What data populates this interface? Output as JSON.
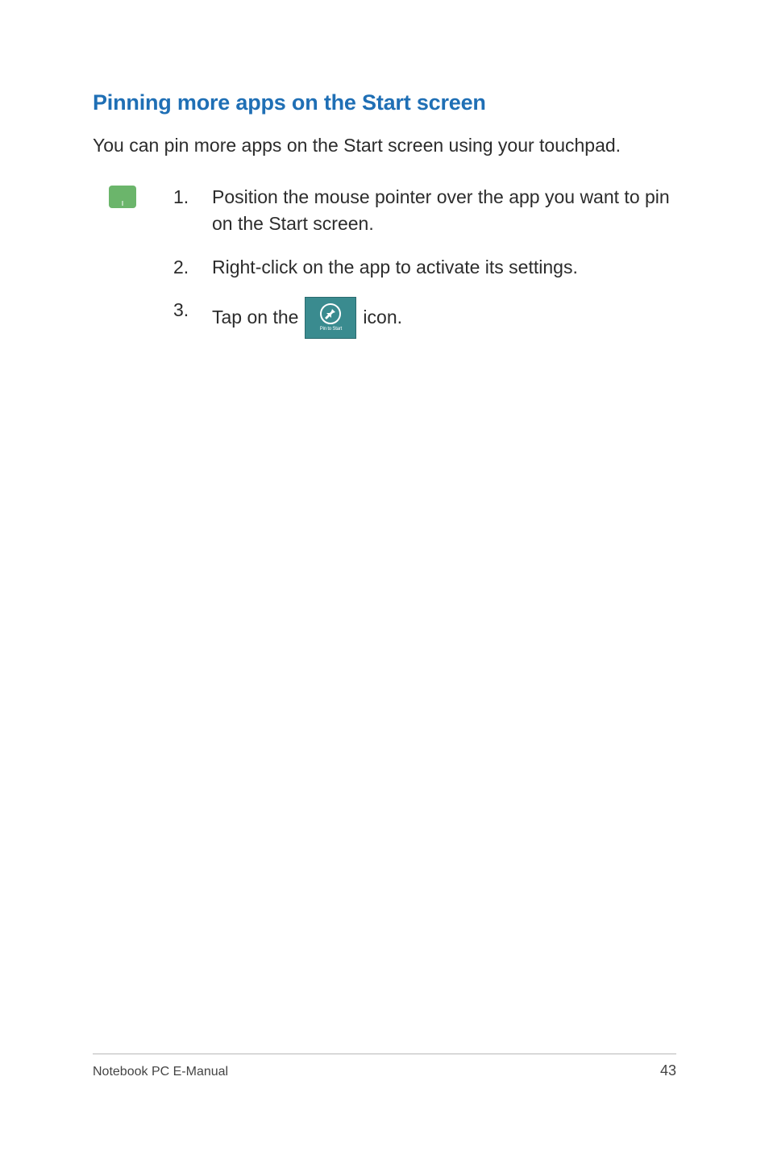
{
  "heading": "Pinning more apps on the Start screen",
  "intro": "You can pin more apps on the Start screen using your touchpad.",
  "steps": [
    {
      "num": "1.",
      "text": "Position the mouse pointer over the app you want to pin on the Start screen."
    },
    {
      "num": "2.",
      "text": "Right-click on the app to activate its settings."
    },
    {
      "num": "3.",
      "before": "Tap on the ",
      "after": " icon."
    }
  ],
  "pin_icon_label": "Pin to Start",
  "footer": {
    "title": "Notebook PC E-Manual",
    "page": "43"
  }
}
